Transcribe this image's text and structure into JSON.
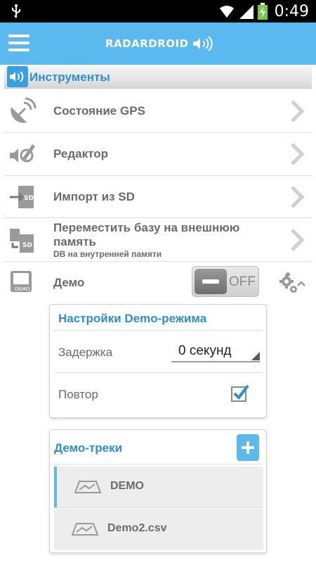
{
  "status_bar": {
    "time": "0:49",
    "icons": [
      "usb-icon",
      "wifi-icon",
      "signal-icon",
      "battery-charging-icon"
    ]
  },
  "app_bar": {
    "logo_text": "RADARDROID",
    "icons": [
      "menu-icon",
      "radar-signal-icon"
    ]
  },
  "section": {
    "title": "Инструменты",
    "icon": "radar-signal-icon"
  },
  "tools": [
    {
      "label": "Состояние GPS",
      "icon": "satellite-dish-icon"
    },
    {
      "label": "Редактор",
      "icon": "editor-pencil-icon"
    },
    {
      "label": "Импорт из SD",
      "icon": "sd-import-icon"
    },
    {
      "label_line1": "Переместить базу на внешнюю",
      "label_line2": "память",
      "sublabel": "DB на внутренней памяти",
      "icon": "sd-move-icon"
    }
  ],
  "demo": {
    "label": "Демо",
    "icon": "demo-monitor-icon",
    "toggle_text": "OFF",
    "toggle_on": false,
    "settings_icon": "gears-collapse-icon"
  },
  "demo_settings": {
    "title": "Настройки Demo-режима",
    "delay_label": "Задержка",
    "delay_value": "0 секунд",
    "repeat_label": "Повтор",
    "repeat_checked": true
  },
  "demo_tracks": {
    "title": "Демо-треки",
    "add_icon": "plus-icon",
    "items": [
      {
        "name": "DEMO",
        "selected": true,
        "icon": "track-map-icon"
      },
      {
        "name": "Demo2.csv",
        "selected": false,
        "icon": "track-map-icon"
      }
    ]
  },
  "colors": {
    "accent": "#5ab9ef",
    "title_blue": "#2a8fd6",
    "text_gray": "#6b6b6b"
  }
}
